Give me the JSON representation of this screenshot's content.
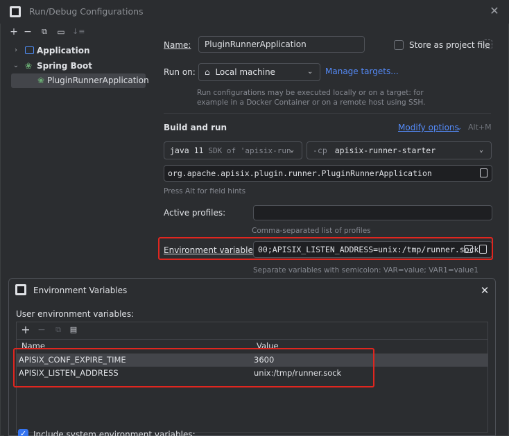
{
  "window": {
    "title": "Run/Debug Configurations"
  },
  "tree": {
    "items": [
      {
        "label": "Application"
      },
      {
        "label": "Spring Boot"
      },
      {
        "label": "PluginRunnerApplication"
      }
    ]
  },
  "form": {
    "name_label": "Name:",
    "name_value": "PluginRunnerApplication",
    "store_label": "Store as project file",
    "run_on_label": "Run on:",
    "run_on_value": "Local machine",
    "manage_targets": "Manage targets...",
    "run_on_hint_1": "Run configurations may be executed locally or on a target: for",
    "run_on_hint_2": "example in a Docker Container or on a remote host using SSH.",
    "build_run_label": "Build and run",
    "modify_options": "Modify options",
    "modify_shortcut": "Alt+M",
    "jdk_name": "java 11",
    "jdk_detail": "SDK of 'apisix-run",
    "cp_flag": "-cp",
    "cp_value": "apisix-runner-starter",
    "main_class": "org.apache.apisix.plugin.runner.PluginRunnerApplication",
    "field_hint": "Press Alt for field hints",
    "profiles_label": "Active profiles:",
    "profiles_value": "",
    "profiles_hint": "Comma-separated list of profiles",
    "env_label": "Environment variables:",
    "env_value": "00;APISIX_LISTEN_ADDRESS=unix:/tmp/runner.sock",
    "env_hint": "Separate variables with semicolon: VAR=value; VAR1=value1"
  },
  "env_dialog": {
    "title": "Environment Variables",
    "user_label": "User environment variables:",
    "col_name": "Name",
    "col_value": "Value",
    "rows": [
      {
        "name": "APISIX_CONF_EXPIRE_TIME",
        "value": "3600"
      },
      {
        "name": "APISIX_LISTEN_ADDRESS",
        "value": "unix:/tmp/runner.sock"
      }
    ],
    "include_system": "Include system environment variables:"
  },
  "colors": {
    "accent": "#548af7",
    "highlight": "#e0261f",
    "background": "#2b2d30"
  }
}
